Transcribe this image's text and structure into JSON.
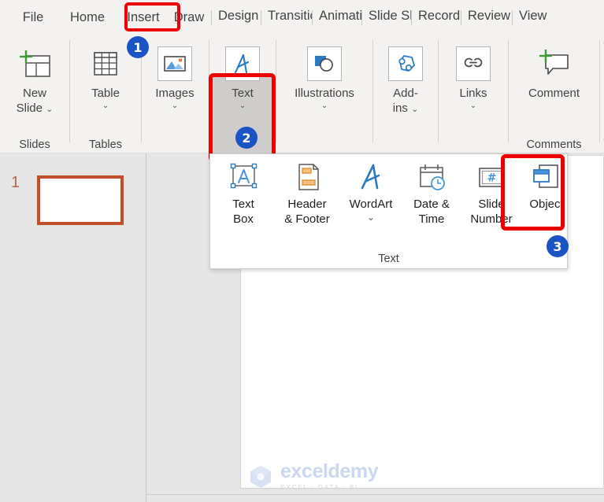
{
  "tabs": [
    {
      "label": "File",
      "name": "tab-file",
      "clipped": false
    },
    {
      "label": "Home",
      "name": "tab-home",
      "clipped": false
    },
    {
      "label": "Insert",
      "name": "tab-insert",
      "clipped": false,
      "highlighted": true
    },
    {
      "label": "Draw",
      "name": "tab-draw",
      "clipped": false
    },
    {
      "label": "Design",
      "name": "tab-design",
      "clipped": true
    },
    {
      "label": "Transitions",
      "name": "tab-transitions",
      "clipped": true
    },
    {
      "label": "Animations",
      "name": "tab-animations",
      "clipped": true
    },
    {
      "label": "Slide Show",
      "name": "tab-slide-show",
      "clipped": true
    },
    {
      "label": "Recording",
      "name": "tab-recording",
      "clipped": true
    },
    {
      "label": "Review",
      "name": "tab-review",
      "clipped": true
    },
    {
      "label": "View",
      "name": "tab-view",
      "clipped": true
    }
  ],
  "ribbon": {
    "groups": [
      {
        "label": "Slides",
        "buttons": [
          {
            "label_line1": "New",
            "label_line2": "Slide",
            "icon": "new-slide-icon",
            "chevron_inline": true
          }
        ]
      },
      {
        "label": "Tables",
        "buttons": [
          {
            "label_line1": "Table",
            "icon": "table-icon",
            "chevron": true
          }
        ]
      },
      {
        "label": "",
        "buttons": [
          {
            "label_line1": "Images",
            "icon": "images-icon",
            "chevron": true
          }
        ]
      },
      {
        "label": "",
        "buttons": [
          {
            "label_line1": "Text",
            "icon": "text-wordart-icon",
            "chevron": true,
            "pressed": true,
            "highlighted": true
          }
        ]
      },
      {
        "label": "",
        "buttons": [
          {
            "label_line1": "Illustrations",
            "icon": "illustrations-icon",
            "chevron": true
          }
        ]
      },
      {
        "label": "",
        "buttons": [
          {
            "label_line1": "Add-",
            "label_line2": "ins",
            "icon": "addins-icon",
            "chevron_inline": true
          }
        ]
      },
      {
        "label": "",
        "buttons": [
          {
            "label_line1": "Links",
            "icon": "links-icon",
            "chevron": true
          }
        ]
      },
      {
        "label": "Comments",
        "buttons": [
          {
            "label_line1": "Comment",
            "icon": "comment-icon"
          }
        ]
      }
    ]
  },
  "text_dropdown": {
    "group_label": "Text",
    "items": [
      {
        "label_line1": "Text",
        "label_line2": "Box",
        "icon": "text-box-icon"
      },
      {
        "label_line1": "Header",
        "label_line2": "& Footer",
        "icon": "header-footer-icon"
      },
      {
        "label_line1": "WordArt",
        "label_line2": "",
        "icon": "wordart-icon",
        "chevron": true
      },
      {
        "label_line1": "Date &",
        "label_line2": "Time",
        "icon": "date-time-icon"
      },
      {
        "label_line1": "Slide",
        "label_line2": "Number",
        "icon": "slide-number-icon"
      },
      {
        "label_line1": "Object",
        "label_line2": "",
        "icon": "object-icon",
        "highlighted": true
      }
    ]
  },
  "badges": [
    {
      "number": "1"
    },
    {
      "number": "2"
    },
    {
      "number": "3"
    }
  ],
  "slide_pane": {
    "slide_number": "1"
  },
  "watermark": {
    "main": "exceldemy",
    "sub": "EXCEL - DATA - BI"
  },
  "colors": {
    "highlight_red": "#ee0000",
    "badge_blue": "#1a53c4",
    "thumb_border": "#c0502a",
    "ribbon_bg": "#f3f2f1",
    "pane_bg": "#e6e6e6",
    "accent_blue": "#2a7ac4"
  }
}
